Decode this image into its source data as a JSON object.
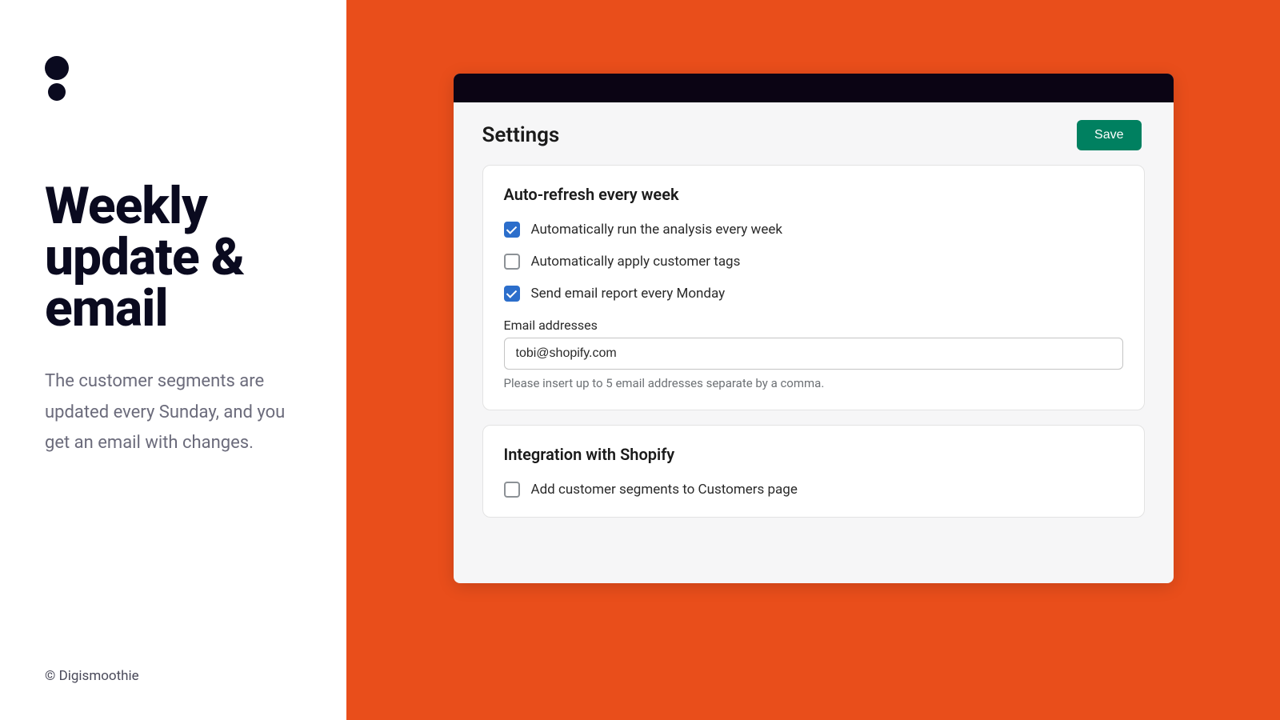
{
  "left": {
    "headline": "Weekly update & email",
    "description": "The customer segments are updated every Sunday, and you get an email with changes.",
    "copyright": "© Digismoothie"
  },
  "settings": {
    "title": "Settings",
    "save_label": "Save",
    "section1": {
      "title": "Auto-refresh every week",
      "check1": {
        "label": "Automatically run the analysis every week",
        "checked": true
      },
      "check2": {
        "label": "Automatically apply customer tags",
        "checked": false
      },
      "check3": {
        "label": "Send email report every Monday",
        "checked": true
      },
      "email_field_label": "Email addresses",
      "email_value": "tobi@shopify.com",
      "email_help": "Please insert up to 5 email addresses separate by a comma."
    },
    "section2": {
      "title": "Integration with Shopify",
      "check1": {
        "label": "Add customer segments to Customers page",
        "checked": false
      }
    }
  }
}
